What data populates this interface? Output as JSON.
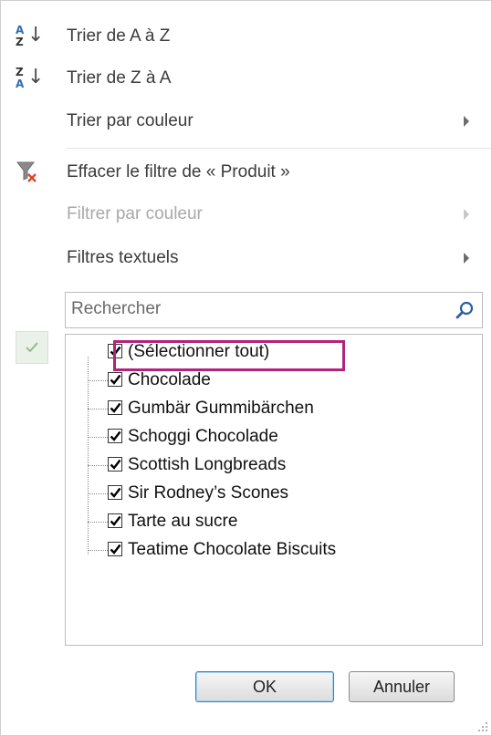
{
  "menu": {
    "sort_az": {
      "label": "Trier de A à Z",
      "icon": "sort-az-icon",
      "icon_letters": [
        "A",
        "Z"
      ]
    },
    "sort_za": {
      "label": "Trier de Z à A",
      "icon": "sort-za-icon",
      "icon_letters": [
        "Z",
        "A"
      ]
    },
    "sort_color": {
      "label": "Trier par couleur"
    },
    "clear_filter": {
      "label": "Effacer le filtre de « Produit »",
      "icon": "clear-filter-icon"
    },
    "filter_color": {
      "label": "Filtrer par couleur",
      "disabled": true
    },
    "text_filters": {
      "label": "Filtres textuels"
    }
  },
  "search": {
    "placeholder": "Rechercher",
    "value": ""
  },
  "list": {
    "select_all": {
      "label": "(Sélectionner tout)",
      "checked": true
    },
    "items": [
      {
        "label": "Chocolade",
        "checked": true
      },
      {
        "label": "Gumbär Gummibärchen",
        "checked": true
      },
      {
        "label": "Schoggi Chocolade",
        "checked": true
      },
      {
        "label": "Scottish Longbreads",
        "checked": true
      },
      {
        "label": "Sir Rodney’s Scones",
        "checked": true
      },
      {
        "label": "Tarte au sucre",
        "checked": true
      },
      {
        "label": "Teatime Chocolate Biscuits",
        "checked": true
      }
    ]
  },
  "buttons": {
    "ok": "OK",
    "cancel": "Annuler"
  },
  "colors": {
    "highlight": "#b0247a",
    "accent": "#3c7fb1"
  }
}
